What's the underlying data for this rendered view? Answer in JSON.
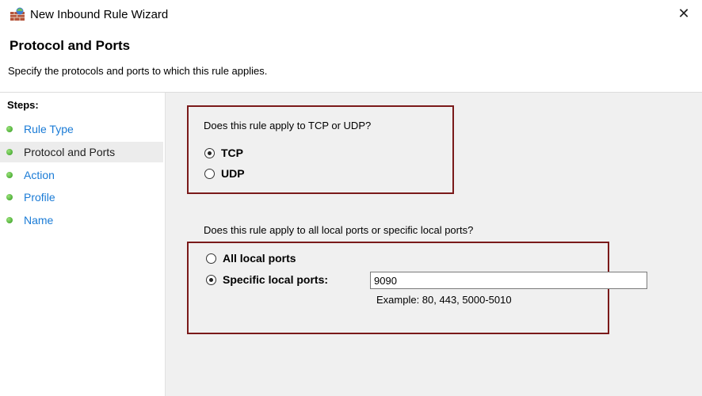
{
  "window": {
    "title": "New Inbound Rule Wizard",
    "close_glyph": "✕"
  },
  "header": {
    "title": "Protocol and Ports",
    "subtitle": "Specify the protocols and ports to which this rule applies."
  },
  "sidebar": {
    "title": "Steps:",
    "items": [
      {
        "label": "Rule Type",
        "current": false
      },
      {
        "label": "Protocol and Ports",
        "current": true
      },
      {
        "label": "Action",
        "current": false
      },
      {
        "label": "Profile",
        "current": false
      },
      {
        "label": "Name",
        "current": false
      }
    ]
  },
  "protocol": {
    "question": "Does this rule apply to TCP or UDP?",
    "options": [
      {
        "label": "TCP",
        "selected": true
      },
      {
        "label": "UDP",
        "selected": false
      }
    ]
  },
  "ports": {
    "question": "Does this rule apply to all local ports or specific local ports?",
    "options": [
      {
        "label": "All local ports",
        "selected": false
      },
      {
        "label": "Specific local ports:",
        "selected": true
      }
    ],
    "input_value": "9090",
    "example": "Example: 80, 443, 5000-5010"
  },
  "colors": {
    "highlight_frame": "#7a1a1a",
    "link_blue": "#1a7bd6",
    "content_bg": "#f0f0f0"
  },
  "icons": {
    "app": "firewall-wall-icon",
    "step": "green-dot-icon",
    "close": "close-icon"
  }
}
